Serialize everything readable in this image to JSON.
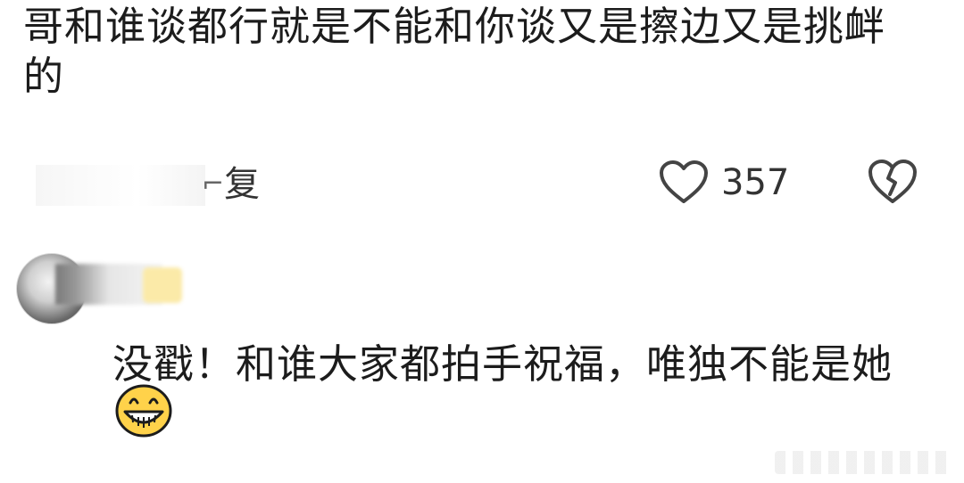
{
  "comment": {
    "text": "哥和谁谈都行就是不能和你谈又是擦边又是挑衅的",
    "reply_label": "复",
    "like_count": "357",
    "icons": {
      "like": "heart-outline-icon",
      "dislike": "broken-heart-icon"
    }
  },
  "reply": {
    "text": "没戳！和谁大家都拍手祝福，唯独不能是她",
    "emoji": "grinning-face-emoji"
  },
  "colors": {
    "text": "#1c1c1c",
    "icon": "#444444",
    "badge": "#fbeaa8"
  }
}
